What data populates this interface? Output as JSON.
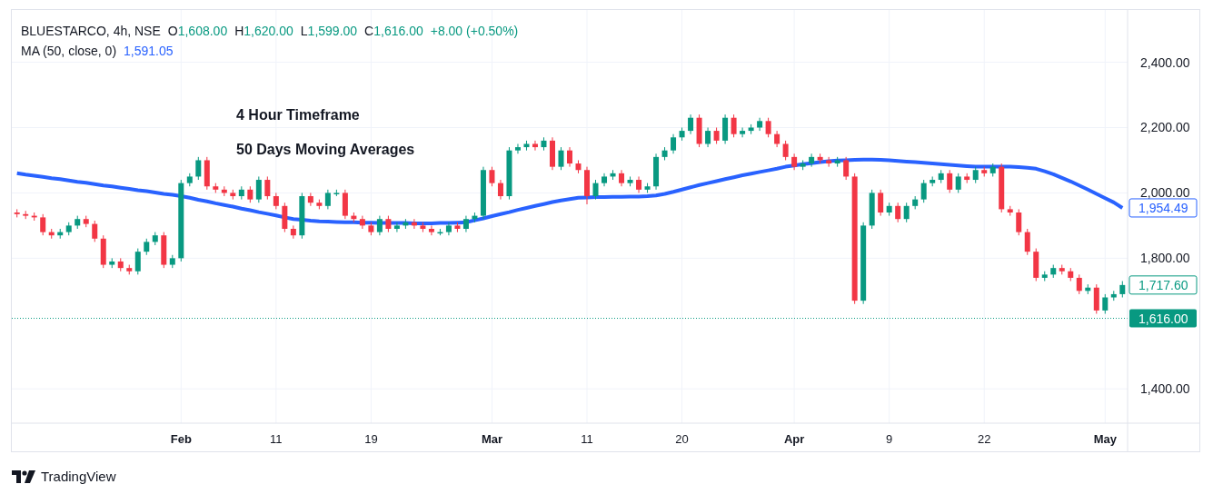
{
  "legend": {
    "symbol": "BLUESTARCO, 4h, NSE",
    "values": [
      {
        "key": "O",
        "value": "1,608.00"
      },
      {
        "key": "H",
        "value": "1,620.00"
      },
      {
        "key": "L",
        "value": "1,599.00"
      },
      {
        "key": "C",
        "value": "1,616.00"
      }
    ],
    "change": "+8.00 (+0.50%)"
  },
  "ma_legend": {
    "value": "1,591.05"
  },
  "notes": [
    "4 Hour Timeframe",
    "50 Days Moving Averages"
  ],
  "chart_data": {
    "type": "candlestick",
    "grid": true,
    "ylim": [
      1295,
      2560
    ],
    "yticks": [
      {
        "value": 2400,
        "label": "2,400.00"
      },
      {
        "value": 2200,
        "label": "2,200.00"
      },
      {
        "value": 2000,
        "label": "2,000.00"
      },
      {
        "value": 1800,
        "label": "1,800.00"
      },
      {
        "value": 1400,
        "label": "1,400.00"
      }
    ],
    "categories": [
      null,
      null,
      null,
      null,
      null,
      null,
      null,
      null,
      null,
      null,
      null,
      null,
      null,
      null,
      null,
      null,
      null,
      null,
      null,
      "Feb",
      null,
      null,
      null,
      null,
      null,
      null,
      null,
      null,
      null,
      null,
      "11",
      null,
      null,
      null,
      null,
      null,
      null,
      null,
      null,
      null,
      null,
      "19",
      null,
      null,
      null,
      null,
      null,
      null,
      null,
      null,
      null,
      null,
      null,
      null,
      null,
      "Mar",
      null,
      null,
      null,
      null,
      null,
      null,
      null,
      null,
      null,
      null,
      "11",
      null,
      null,
      null,
      null,
      null,
      null,
      null,
      null,
      null,
      null,
      "20",
      null,
      null,
      null,
      null,
      null,
      null,
      null,
      null,
      null,
      null,
      null,
      null,
      "Apr",
      null,
      null,
      null,
      null,
      null,
      null,
      null,
      null,
      null,
      null,
      "9",
      null,
      null,
      null,
      null,
      null,
      null,
      null,
      null,
      null,
      null,
      "22",
      null,
      null,
      null,
      null,
      null,
      null,
      null,
      null,
      null,
      null,
      null,
      null,
      null,
      "May",
      null,
      null
    ],
    "ohlc": [
      [
        1940,
        1950,
        1925,
        1935
      ],
      [
        1935,
        1945,
        1920,
        1930
      ],
      [
        1930,
        1940,
        1915,
        1925
      ],
      [
        1925,
        1935,
        1870,
        1880
      ],
      [
        1880,
        1890,
        1860,
        1870
      ],
      [
        1870,
        1890,
        1860,
        1880
      ],
      [
        1880,
        1910,
        1870,
        1900
      ],
      [
        1900,
        1930,
        1890,
        1920
      ],
      [
        1920,
        1930,
        1895,
        1905
      ],
      [
        1905,
        1915,
        1850,
        1860
      ],
      [
        1860,
        1870,
        1770,
        1780
      ],
      [
        1780,
        1800,
        1770,
        1790
      ],
      [
        1790,
        1800,
        1760,
        1770
      ],
      [
        1770,
        1780,
        1750,
        1760
      ],
      [
        1760,
        1830,
        1750,
        1820
      ],
      [
        1820,
        1860,
        1810,
        1850
      ],
      [
        1850,
        1880,
        1840,
        1870
      ],
      [
        1870,
        1880,
        1770,
        1780
      ],
      [
        1780,
        1810,
        1770,
        1800
      ],
      [
        1800,
        2040,
        1790,
        2030
      ],
      [
        2030,
        2060,
        2020,
        2050
      ],
      [
        2050,
        2110,
        2040,
        2100
      ],
      [
        2100,
        2110,
        2010,
        2020
      ],
      [
        2020,
        2030,
        2000,
        2010
      ],
      [
        2010,
        2020,
        1990,
        2000
      ],
      [
        2000,
        2010,
        1980,
        1990
      ],
      [
        1990,
        2020,
        1980,
        2010
      ],
      [
        2010,
        2020,
        1970,
        1980
      ],
      [
        1980,
        2050,
        1970,
        2040
      ],
      [
        2040,
        2050,
        1980,
        1990
      ],
      [
        1990,
        2000,
        1950,
        1960
      ],
      [
        1960,
        1970,
        1880,
        1890
      ],
      [
        1890,
        1900,
        1860,
        1870
      ],
      [
        1870,
        2000,
        1860,
        1990
      ],
      [
        1990,
        2000,
        1960,
        1970
      ],
      [
        1970,
        1980,
        1950,
        1960
      ],
      [
        1960,
        2010,
        1950,
        2000
      ],
      [
        2000,
        2010,
        1990,
        2000
      ],
      [
        2000,
        2010,
        1920,
        1930
      ],
      [
        1930,
        1940,
        1910,
        1920
      ],
      [
        1920,
        1930,
        1890,
        1900
      ],
      [
        1900,
        1910,
        1870,
        1880
      ],
      [
        1880,
        1930,
        1870,
        1920
      ],
      [
        1920,
        1930,
        1880,
        1890
      ],
      [
        1890,
        1910,
        1880,
        1900
      ],
      [
        1900,
        1920,
        1890,
        1910
      ],
      [
        1910,
        1920,
        1890,
        1900
      ],
      [
        1900,
        1910,
        1880,
        1890
      ],
      [
        1890,
        1900,
        1870,
        1880
      ],
      [
        1880,
        1890,
        1870,
        1880
      ],
      [
        1880,
        1910,
        1870,
        1900
      ],
      [
        1900,
        1910,
        1880,
        1890
      ],
      [
        1890,
        1930,
        1880,
        1920
      ],
      [
        1920,
        1940,
        1910,
        1930
      ],
      [
        1930,
        2080,
        1920,
        2070
      ],
      [
        2070,
        2080,
        2020,
        2030
      ],
      [
        2030,
        2040,
        1980,
        1990
      ],
      [
        1990,
        2140,
        1980,
        2130
      ],
      [
        2130,
        2150,
        2120,
        2140
      ],
      [
        2140,
        2160,
        2130,
        2150
      ],
      [
        2150,
        2160,
        2130,
        2140
      ],
      [
        2140,
        2170,
        2130,
        2160
      ],
      [
        2160,
        2170,
        2070,
        2080
      ],
      [
        2080,
        2140,
        2070,
        2130
      ],
      [
        2130,
        2140,
        2080,
        2090
      ],
      [
        2090,
        2100,
        2060,
        2070
      ],
      [
        2070,
        2080,
        1965,
        1990
      ],
      [
        1990,
        2040,
        1980,
        2030
      ],
      [
        2030,
        2060,
        2020,
        2050
      ],
      [
        2050,
        2070,
        2040,
        2060
      ],
      [
        2060,
        2070,
        2020,
        2030
      ],
      [
        2030,
        2050,
        2020,
        2040
      ],
      [
        2040,
        2050,
        2000,
        2010
      ],
      [
        2010,
        2030,
        2000,
        2020
      ],
      [
        2020,
        2120,
        2010,
        2110
      ],
      [
        2110,
        2140,
        2100,
        2130
      ],
      [
        2130,
        2180,
        2120,
        2170
      ],
      [
        2170,
        2200,
        2160,
        2190
      ],
      [
        2190,
        2240,
        2180,
        2230
      ],
      [
        2230,
        2240,
        2140,
        2150
      ],
      [
        2150,
        2200,
        2140,
        2190
      ],
      [
        2190,
        2200,
        2150,
        2160
      ],
      [
        2160,
        2240,
        2150,
        2230
      ],
      [
        2230,
        2240,
        2170,
        2180
      ],
      [
        2180,
        2200,
        2170,
        2190
      ],
      [
        2190,
        2210,
        2180,
        2200
      ],
      [
        2200,
        2230,
        2190,
        2220
      ],
      [
        2220,
        2230,
        2170,
        2180
      ],
      [
        2180,
        2190,
        2140,
        2150
      ],
      [
        2150,
        2160,
        2100,
        2110
      ],
      [
        2110,
        2120,
        2070,
        2080
      ],
      [
        2080,
        2100,
        2070,
        2090
      ],
      [
        2090,
        2120,
        2080,
        2110
      ],
      [
        2110,
        2120,
        2090,
        2100
      ],
      [
        2100,
        2110,
        2080,
        2090
      ],
      [
        2090,
        2110,
        2080,
        2100
      ],
      [
        2100,
        2110,
        2040,
        2050
      ],
      [
        2050,
        2060,
        1660,
        1670
      ],
      [
        1670,
        1910,
        1660,
        1900
      ],
      [
        1900,
        2010,
        1890,
        2000
      ],
      [
        2000,
        2010,
        1930,
        1940
      ],
      [
        1940,
        1970,
        1930,
        1960
      ],
      [
        1960,
        1970,
        1910,
        1920
      ],
      [
        1920,
        1970,
        1910,
        1960
      ],
      [
        1960,
        1990,
        1950,
        1980
      ],
      [
        1980,
        2040,
        1970,
        2030
      ],
      [
        2030,
        2050,
        2020,
        2040
      ],
      [
        2040,
        2070,
        2030,
        2060
      ],
      [
        2060,
        2070,
        2000,
        2010
      ],
      [
        2010,
        2060,
        2000,
        2050
      ],
      [
        2050,
        2060,
        2030,
        2040
      ],
      [
        2040,
        2080,
        2030,
        2070
      ],
      [
        2070,
        2080,
        2050,
        2060
      ],
      [
        2060,
        2090,
        2050,
        2080
      ],
      [
        2080,
        2090,
        1940,
        1950
      ],
      [
        1950,
        1960,
        1930,
        1940
      ],
      [
        1940,
        1950,
        1870,
        1880
      ],
      [
        1880,
        1890,
        1810,
        1820
      ],
      [
        1820,
        1830,
        1730,
        1740
      ],
      [
        1740,
        1760,
        1730,
        1750
      ],
      [
        1750,
        1780,
        1740,
        1770
      ],
      [
        1770,
        1780,
        1750,
        1760
      ],
      [
        1760,
        1770,
        1730,
        1740
      ],
      [
        1740,
        1750,
        1690,
        1700
      ],
      [
        1700,
        1720,
        1690,
        1710
      ],
      [
        1710,
        1720,
        1630,
        1640
      ],
      [
        1640,
        1690,
        1630,
        1680
      ],
      [
        1680,
        1700,
        1670,
        1690
      ],
      [
        1690,
        1730,
        1680,
        1718
      ]
    ],
    "series": [
      {
        "name": "MA (50, close, 0)",
        "type": "line",
        "color": "#2962ff",
        "values": [
          2060,
          2056,
          2053,
          2049,
          2045,
          2042,
          2038,
          2034,
          2031,
          2027,
          2023,
          2020,
          2016,
          2012,
          2008,
          2005,
          2001,
          1997,
          1994,
          1990,
          1985,
          1979,
          1974,
          1968,
          1963,
          1958,
          1952,
          1947,
          1941,
          1936,
          1931,
          1925,
          1920,
          1918,
          1915,
          1913,
          1912,
          1911,
          1910,
          1910,
          1909,
          1909,
          1908,
          1908,
          1908,
          1908,
          1907,
          1907,
          1907,
          1908,
          1908,
          1909,
          1910,
          1916,
          1922,
          1929,
          1935,
          1941,
          1948,
          1954,
          1960,
          1966,
          1972,
          1977,
          1981,
          1985,
          1986,
          1987,
          1987,
          1988,
          1988,
          1989,
          1989,
          1990,
          1992,
          1997,
          2003,
          2010,
          2017,
          2024,
          2030,
          2036,
          2042,
          2048,
          2054,
          2059,
          2064,
          2069,
          2074,
          2080,
          2084,
          2088,
          2091,
          2094,
          2097,
          2099,
          2100,
          2101,
          2102,
          2102,
          2101,
          2100,
          2098,
          2096,
          2094,
          2092,
          2090,
          2088,
          2086,
          2084,
          2082,
          2080,
          2080,
          2080,
          2080,
          2080,
          2079,
          2077,
          2074,
          2066,
          2057,
          2046,
          2035,
          2023,
          2010,
          1997,
          1984,
          1971,
          1954
        ]
      }
    ],
    "ref_lines": [
      {
        "axis": "y",
        "value": 1616,
        "label": "1,616.00",
        "color": "#089981"
      }
    ]
  },
  "time_axis": {
    "bold": [
      true,
      false,
      false,
      true,
      false,
      false,
      true,
      false,
      false,
      true
    ]
  },
  "price_tags": [
    {
      "label": "1,954.49",
      "kind": "line"
    },
    {
      "label": "1,717.60",
      "kind": "candle"
    }
  ],
  "footer": {
    "brand": "TradingView"
  }
}
